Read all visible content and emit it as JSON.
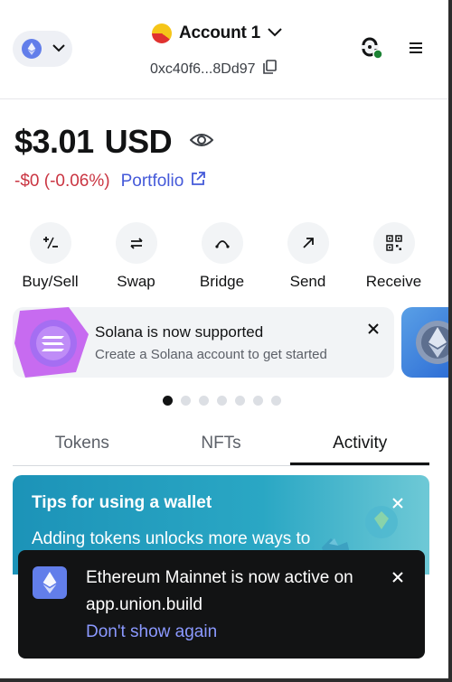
{
  "header": {
    "account_name": "Account 1",
    "address": "0xc40f6...8Dd97"
  },
  "balance": {
    "amount": "$3.01",
    "currency": "USD",
    "change": "-$0 (-0.06%)",
    "portfolio_label": "Portfolio"
  },
  "actions": [
    {
      "label": "Buy/Sell",
      "icon": "plus-minus-icon"
    },
    {
      "label": "Swap",
      "icon": "swap-arrows-icon"
    },
    {
      "label": "Bridge",
      "icon": "bridge-icon"
    },
    {
      "label": "Send",
      "icon": "arrow-up-right-icon"
    },
    {
      "label": "Receive",
      "icon": "qr-code-icon"
    }
  ],
  "banner": {
    "title": "Solana is now supported",
    "subtitle": "Create a Solana account to get started"
  },
  "carousel": {
    "total": 7,
    "active_index": 0
  },
  "tabs": [
    {
      "label": "Tokens",
      "active": false
    },
    {
      "label": "NFTs",
      "active": false
    },
    {
      "label": "Activity",
      "active": true
    }
  ],
  "tips": {
    "title": "Tips for using a wallet",
    "body": "Adding tokens unlocks more ways to"
  },
  "toast": {
    "line1": "Ethereum Mainnet is now active on",
    "line2": "app.union.build",
    "link": "Don't show again"
  },
  "colors": {
    "accent": "#4459d9",
    "negative": "#ca3542",
    "ethereum": "#627eea",
    "toast_bg": "#121314",
    "toast_link": "#8b99ff"
  }
}
